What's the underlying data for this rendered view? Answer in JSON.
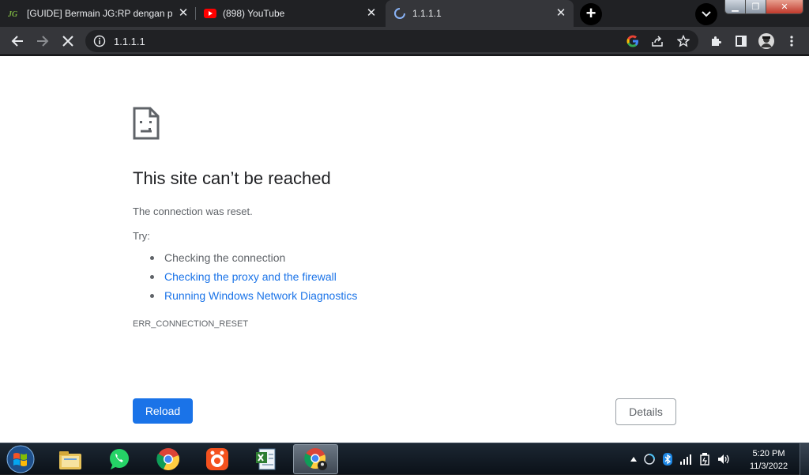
{
  "tabs": [
    {
      "title": "[GUIDE] Bermain JG:RP dengan p",
      "favicon": "jg-logo-icon",
      "active": false
    },
    {
      "title": "(898) YouTube",
      "favicon": "youtube-icon",
      "active": false
    },
    {
      "title": "1.1.1.1",
      "favicon": "loading-spinner-icon",
      "active": true
    }
  ],
  "toolbar": {
    "url": "1.1.1.1"
  },
  "page": {
    "heading": "This site can’t be reached",
    "message": "The connection was reset.",
    "try_label": "Try:",
    "suggestions": [
      "Checking the connection",
      "Checking the proxy and the firewall",
      "Running Windows Network Diagnostics"
    ],
    "error_code": "ERR_CONNECTION_RESET",
    "reload_label": "Reload",
    "details_label": "Details"
  },
  "taskbar": {
    "apps": [
      "windows-explorer-icon",
      "whatsapp-icon",
      "chrome-icon",
      "nox-icon",
      "document-icon",
      "chrome-active-icon"
    ],
    "time": "5:20 PM",
    "date": "11/3/2022"
  },
  "colors": {
    "link": "#1a73e8",
    "reload_button": "#1a73e8",
    "text_secondary": "#5f6368",
    "heading": "#202124",
    "toolbar": "#35363a",
    "tabstrip": "#202124"
  }
}
